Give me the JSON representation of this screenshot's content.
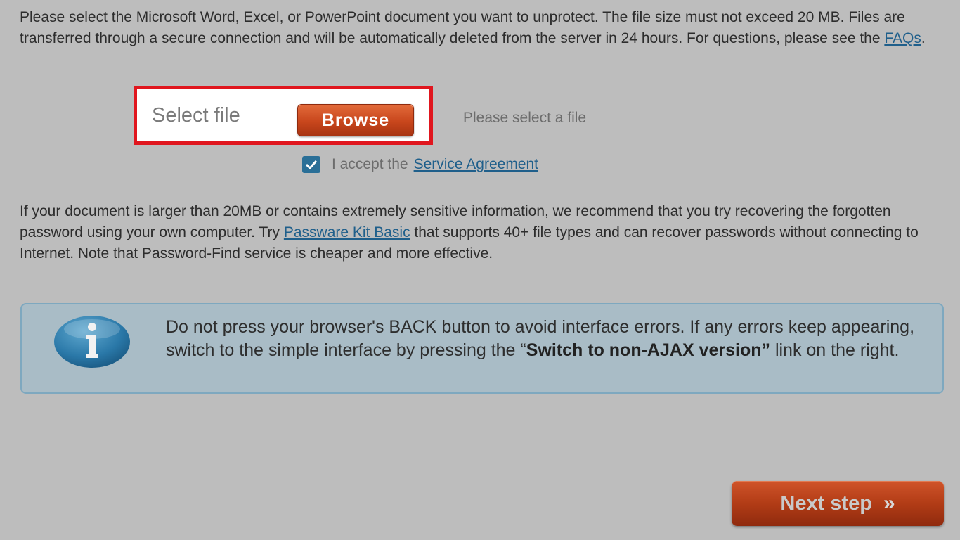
{
  "intro": {
    "text_before_link": "Please select the Microsoft Word, Excel, or PowerPoint document you want to unprotect. The file size must not exceed 20 MB. Files are transferred through a secure connection and will be automatically deleted from the server in 24 hours. For questions, please see the ",
    "faq_link": "FAQs",
    "text_after_link": "."
  },
  "upload": {
    "select_file_label": "Select file",
    "browse_label": "Browse",
    "status_text": "Please select a file"
  },
  "agreement": {
    "checked": true,
    "text": "I accept the",
    "link_label": "Service Agreement"
  },
  "recommendation": {
    "text_before_link": "If your document is larger than 20MB or contains extremely sensitive information, we recommend that you try recovering the forgotten password using your own computer. Try ",
    "link_label": "Passware Kit Basic",
    "text_after_link": " that supports 40+ file types and can recover passwords without connecting to Internet. Note that Password-Find service is cheaper and more effective."
  },
  "info_box": {
    "icon": "info-icon",
    "text_before_bold": "Do not press your browser's BACK button to avoid interface errors. If any errors keep appearing, switch to the simple interface by pressing the “",
    "bold_text": "Switch to non-AJAX version”",
    "text_after_bold": " link on the right."
  },
  "navigation": {
    "next_label": "Next step",
    "next_icon": "double-chevron-right-icon"
  },
  "colors": {
    "background": "#bdbdbd",
    "highlight_border": "#e0161e",
    "button_orange": "#c8461c",
    "link": "#1f5f8b",
    "info_box_bg": "#a9bcc6",
    "checkbox": "#2a6f97"
  }
}
